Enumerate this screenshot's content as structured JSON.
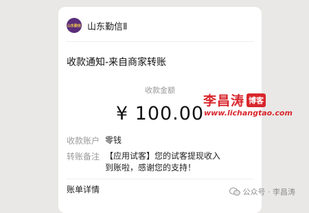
{
  "app": {
    "name": "山东勤信Ⅱ",
    "avatar_text": "山东勤信"
  },
  "notice": {
    "title": "收款通知-来自商家转账"
  },
  "amount": {
    "label": "收款金额",
    "value": "¥ 100.00"
  },
  "fields": [
    {
      "key": "收款账户",
      "value": "零钱"
    },
    {
      "key": "转账备注",
      "value": "【应用试客】您的试客提现收入到账啦，感谢您的支持！"
    }
  ],
  "detail_link": "账单详情",
  "watermark": {
    "name": "李昌涛",
    "badge": "博客",
    "url": "www.lichangtao.com"
  },
  "footer": {
    "source": "公众号 · 李昌涛"
  },
  "colors": {
    "brand_red": "#d8262c",
    "avatar_purple": "#5a2d7a",
    "background": "#e9e8e6"
  }
}
